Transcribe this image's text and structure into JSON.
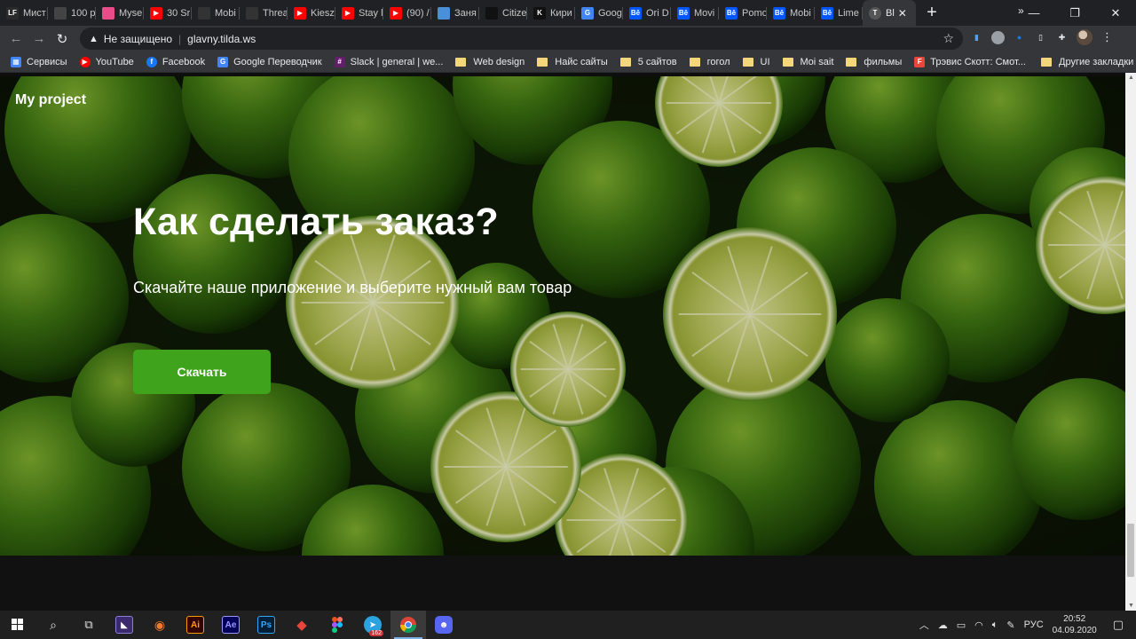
{
  "browser": {
    "tabs": [
      {
        "title": "Мист",
        "fav": "LF",
        "color": "#2b2b2b"
      },
      {
        "title": "100 р",
        "fav": "",
        "color": "#444"
      },
      {
        "title": "Myse",
        "fav": "",
        "color": "#ea4c89"
      },
      {
        "title": "30 Sr",
        "fav": "▶",
        "color": "#ff0000"
      },
      {
        "title": "Mobi",
        "fav": "",
        "color": "#333"
      },
      {
        "title": "Threa",
        "fav": "",
        "color": "#333"
      },
      {
        "title": "Kiesz",
        "fav": "▶",
        "color": "#ff0000"
      },
      {
        "title": "Stay l",
        "fav": "▶",
        "color": "#ff0000"
      },
      {
        "title": "(90) /",
        "fav": "▶",
        "color": "#ff0000"
      },
      {
        "title": "Заня",
        "fav": "",
        "color": "#4a90d9"
      },
      {
        "title": "Citize",
        "fav": "",
        "color": "#111"
      },
      {
        "title": "Кири",
        "fav": "K",
        "color": "#111"
      },
      {
        "title": "Goog",
        "fav": "G",
        "color": "#4285f4"
      },
      {
        "title": "Ori D",
        "fav": "Bē",
        "color": "#0057ff"
      },
      {
        "title": "Movi",
        "fav": "Bē",
        "color": "#0057ff"
      },
      {
        "title": "Pomo",
        "fav": "Bē",
        "color": "#0057ff"
      },
      {
        "title": "Mobi",
        "fav": "Bē",
        "color": "#0057ff"
      },
      {
        "title": "Lime",
        "fav": "Bē",
        "color": "#0057ff"
      }
    ],
    "active_tab_title": "Bl",
    "security_label": "Не защищено",
    "url": "glavny.tilda.ws",
    "bookmarks": [
      {
        "label": "Сервисы",
        "type": "apps"
      },
      {
        "label": "YouTube",
        "type": "youtube"
      },
      {
        "label": "Facebook",
        "type": "facebook"
      },
      {
        "label": "Google Переводчик",
        "type": "translate"
      },
      {
        "label": "Slack | general | we...",
        "type": "slack"
      },
      {
        "label": "Web design",
        "type": "folder"
      },
      {
        "label": "Найс сайты",
        "type": "folder"
      },
      {
        "label": "5 сайтов",
        "type": "folder"
      },
      {
        "label": "гогол",
        "type": "folder"
      },
      {
        "label": "UI",
        "type": "folder"
      },
      {
        "label": "Moi sait",
        "type": "folder"
      },
      {
        "label": "фильмы",
        "type": "folder"
      },
      {
        "label": "Трэвис Скотт: Смот...",
        "type": "figma"
      }
    ],
    "bookmarks_more": "»",
    "other_bookmarks": "Другие закладки"
  },
  "page": {
    "logo": "My project",
    "headline": "Как сделать заказ?",
    "subtitle": "Скачайте наше приложение и выберите нужный вам товар",
    "cta_label": "Скачать",
    "accent_color": "#3fa31c"
  },
  "taskbar": {
    "apps": [
      "start-icon",
      "search-icon",
      "task-view-icon",
      "screen-app-icon",
      "blender-icon",
      "illustrator-icon",
      "after-effects-icon",
      "photoshop-icon",
      "vector-app-icon",
      "figma-icon",
      "telegram-icon",
      "chrome-icon",
      "discord-icon"
    ],
    "telegram_badge": "162",
    "language": "РУС",
    "time": "20:52",
    "date": "04.09.2020"
  }
}
